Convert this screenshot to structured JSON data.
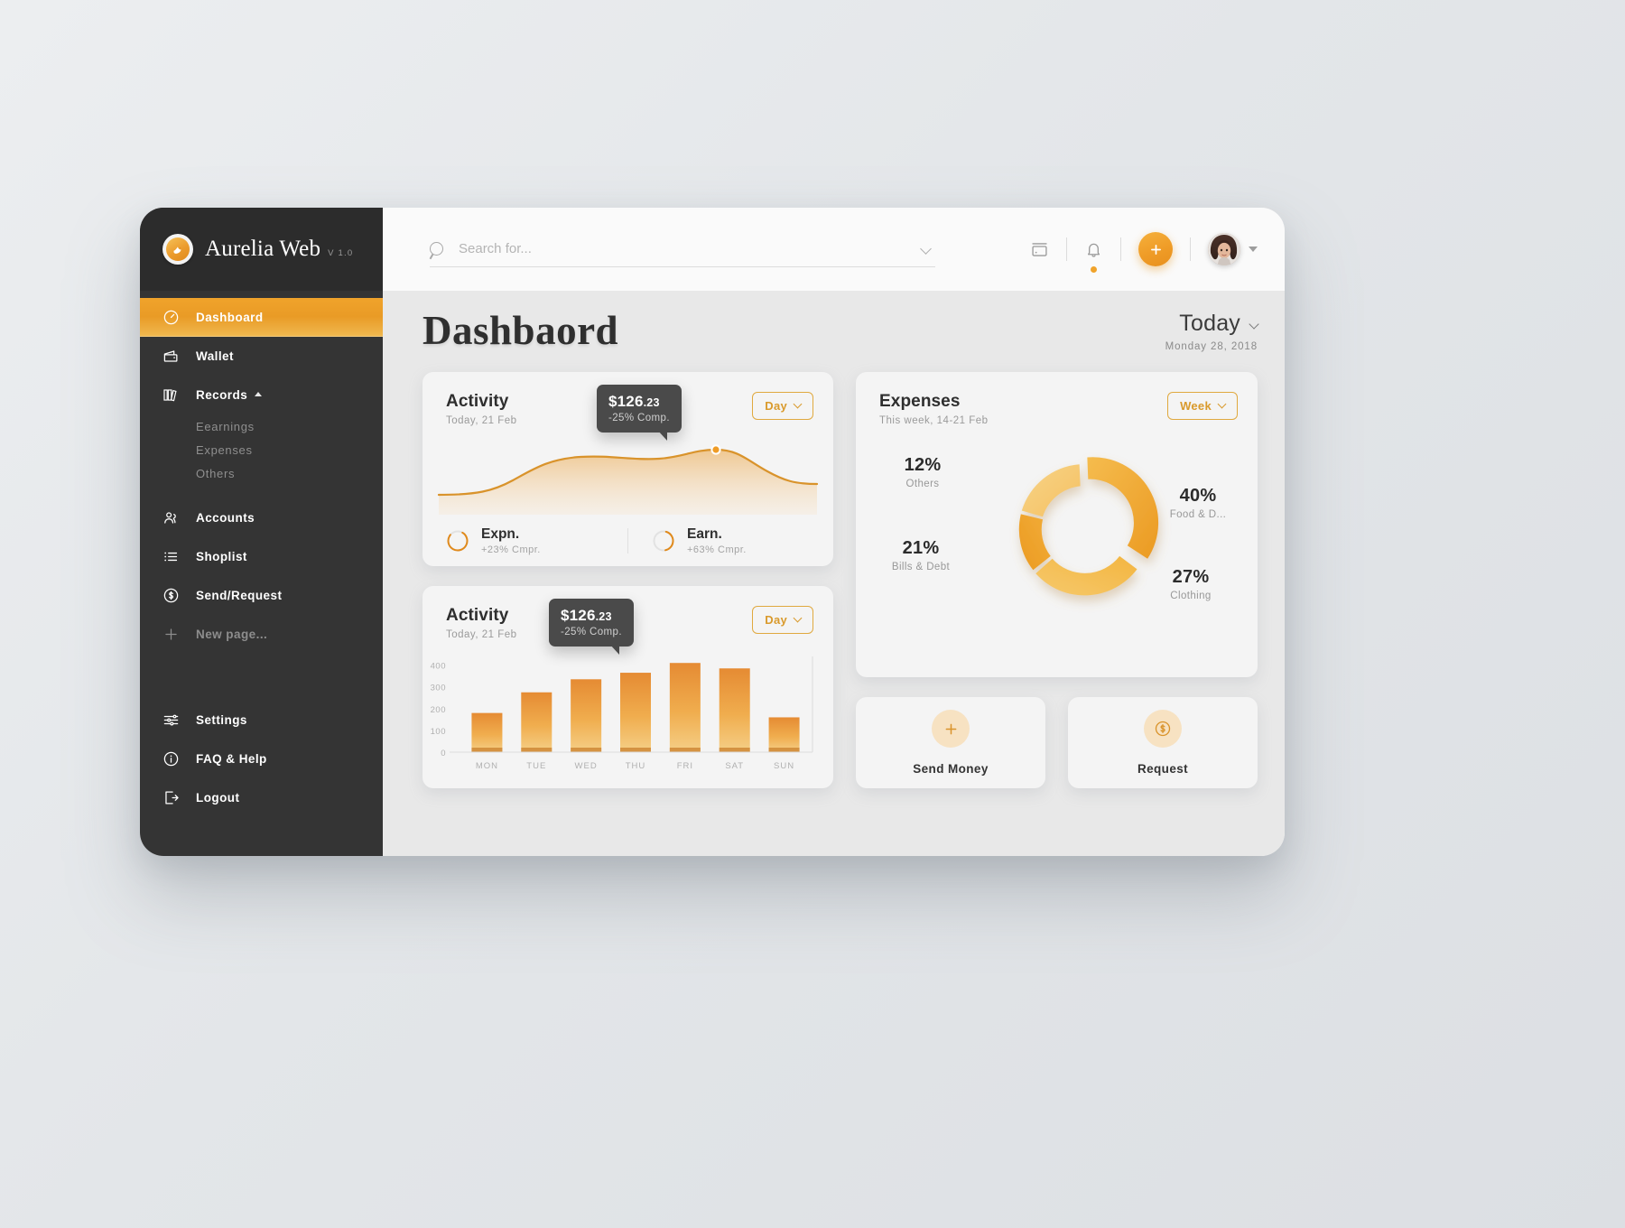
{
  "brand": {
    "name": "Aurelia Web",
    "version": "V 1.0",
    "logo_icon": "bird-logo-icon"
  },
  "sidebar": {
    "items": [
      {
        "label": "Dashboard",
        "icon": "gauge-icon",
        "active": true
      },
      {
        "label": "Wallet",
        "icon": "wallet-icon",
        "active": false
      },
      {
        "label": "Records",
        "icon": "books-icon",
        "active": false,
        "expanded": true
      }
    ],
    "records_children": [
      {
        "label": "Eearnings"
      },
      {
        "label": "Expenses"
      },
      {
        "label": "Others"
      }
    ],
    "items2": [
      {
        "label": "Accounts",
        "icon": "users-icon"
      },
      {
        "label": "Shoplist",
        "icon": "list-icon"
      },
      {
        "label": "Send/Request",
        "icon": "dollar-circle-icon"
      }
    ],
    "new_page": {
      "label": "New page...",
      "icon": "plus-icon"
    },
    "bottom": [
      {
        "label": "Settings",
        "icon": "sliders-icon"
      },
      {
        "label": "FAQ & Help",
        "icon": "info-circle-icon"
      },
      {
        "label": "Logout",
        "icon": "logout-icon"
      }
    ]
  },
  "topbar": {
    "search_placeholder": "Search for...",
    "search_value": "",
    "icons": [
      "inbox-icon",
      "bell-icon"
    ],
    "add_label": "+",
    "has_notification": true
  },
  "page": {
    "title": "Dashbaord",
    "date_label": "Today",
    "date_sub": "Monday 28, 2018"
  },
  "activity_card": {
    "title": "Activity",
    "subtitle": "Today, 21 Feb",
    "range_label": "Day",
    "tooltip": {
      "amount": "$126",
      "cents": ".23",
      "sub": "-25% Comp."
    },
    "stats": [
      {
        "name": "Expn.",
        "compare": "+23% Cmpr.",
        "ring_pct": 78
      },
      {
        "name": "Earn.",
        "compare": "+63% Cmpr.",
        "ring_pct": 42
      }
    ]
  },
  "bar_card": {
    "title": "Activity",
    "subtitle": "Today, 21 Feb",
    "range_label": "Day",
    "tooltip": {
      "amount": "$126",
      "cents": ".23",
      "sub": "-25% Comp."
    }
  },
  "expenses_card": {
    "title": "Expenses",
    "subtitle": "This week, 14-21 Feb",
    "range_label": "Week"
  },
  "actions": [
    {
      "label": "Send Money",
      "icon": "plus-icon"
    },
    {
      "label": "Request",
      "icon": "dollar-circle-icon"
    }
  ],
  "colors": {
    "accent": "#ef9c27",
    "accent_light": "#f5c05a",
    "sidebar_bg": "#343434",
    "tooltip_bg": "#4a4a4a"
  },
  "chart_data": [
    {
      "type": "area",
      "title": "Activity",
      "subtitle": "Today, 21 Feb",
      "x": [
        0,
        1,
        2,
        3,
        4,
        5,
        6,
        7,
        8,
        9,
        10
      ],
      "values": [
        18,
        19,
        22,
        34,
        52,
        60,
        58,
        62,
        66,
        50,
        38
      ],
      "ylim": [
        0,
        80
      ],
      "grid": false,
      "marker": {
        "x": 8,
        "label": "$126.23",
        "sublabel": "-25% Comp."
      },
      "line_color": "#d9932b",
      "fill": "gradient-orange-fade"
    },
    {
      "type": "bar",
      "title": "Activity",
      "subtitle": "Today, 21 Feb",
      "categories": [
        "MON",
        "TUE",
        "WED",
        "THU",
        "FRI",
        "SAT",
        "SUN"
      ],
      "values": [
        180,
        275,
        335,
        365,
        410,
        385,
        160
      ],
      "yticks": [
        0,
        100,
        200,
        300,
        400
      ],
      "ylim": [
        0,
        440
      ],
      "xlabel": "",
      "ylabel": "",
      "grid": false,
      "highlight": {
        "category": "WED",
        "label": "$126.23",
        "sublabel": "-25% Comp."
      },
      "bar_color": "gradient-orange"
    },
    {
      "type": "pie",
      "title": "Expenses",
      "subtitle": "This week, 14-21 Feb",
      "donut": true,
      "labels": [
        "Food & D...",
        "Clothing",
        "Bills & Debt",
        "Others"
      ],
      "values": [
        40,
        27,
        21,
        12
      ],
      "value_labels": [
        "40%",
        "27%",
        "21%",
        "12%"
      ],
      "colors": [
        "#f0a92f",
        "#f3b740",
        "#eea02b",
        "#f6cc72"
      ],
      "legend": "around-slices"
    }
  ]
}
